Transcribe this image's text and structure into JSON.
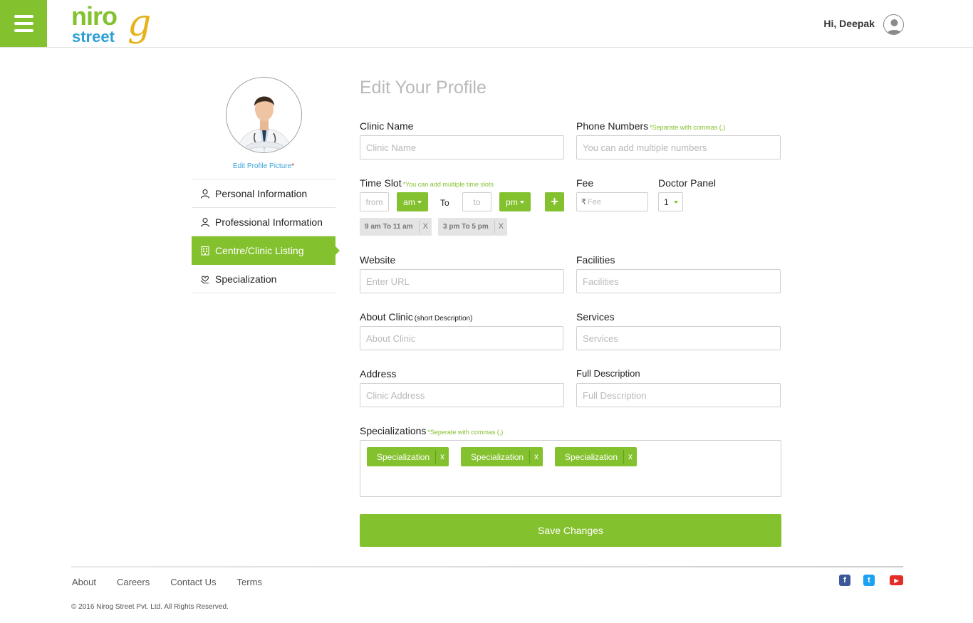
{
  "header": {
    "logo_word1": "niro",
    "logo_word2": "street",
    "logo_mark": "g",
    "greeting": "Hi, Deepak",
    "brand_color": "#84c12e",
    "accent_blue": "#2e9fd6",
    "accent_gold": "#e6b21e"
  },
  "sidebar": {
    "edit_picture": "Edit Profile Picture",
    "edit_star": "*",
    "items": [
      {
        "label": "Personal Information",
        "icon": "user-icon",
        "active": false
      },
      {
        "label": "Professional Information",
        "icon": "user-icon",
        "active": false
      },
      {
        "label": "Centre/Clinic Listing",
        "icon": "clinic-building-icon",
        "active": true
      },
      {
        "label": "Specialization",
        "icon": "heart-hand-icon",
        "active": false
      }
    ]
  },
  "form": {
    "title": "Edit Your Profile",
    "clinic_name": {
      "label": "Clinic Name",
      "placeholder": "Clinic Name",
      "value": ""
    },
    "phone": {
      "label": "Phone Numbers",
      "note": "*Separate with commas (,)",
      "placeholder": "You can add multiple numbers",
      "value": ""
    },
    "time_slot": {
      "label": "Time Slot",
      "note": "*You can add multiple time slots",
      "from_placeholder": "from",
      "from_meridiem": "am",
      "to_text": "To",
      "to_placeholder": "to",
      "to_meridiem": "pm",
      "add_symbol": "+",
      "slots": [
        {
          "text": "9 am To 11 am",
          "remove": "X"
        },
        {
          "text": "3 pm To 5 pm",
          "remove": "X"
        }
      ]
    },
    "fee": {
      "label": "Fee",
      "currency": "₹",
      "placeholder": "Fee",
      "value": ""
    },
    "doctor_panel": {
      "label": "Doctor Panel",
      "value": "1"
    },
    "website": {
      "label": "Website",
      "placeholder": "Enter URL",
      "value": ""
    },
    "facilities": {
      "label": "Facilities",
      "placeholder": "Facilities",
      "value": ""
    },
    "about": {
      "label": "About Clinic",
      "note": "(short Description)",
      "placeholder": "About Clinic",
      "value": ""
    },
    "services": {
      "label": "Services",
      "placeholder": "Services",
      "value": ""
    },
    "address": {
      "label": "Address",
      "placeholder": "Clinic Address",
      "value": ""
    },
    "full_description": {
      "label": "Full Description",
      "placeholder": "Full Description",
      "value": ""
    },
    "specializations": {
      "label": "Specializations",
      "note": "*Seperate with commas (,)",
      "chips": [
        {
          "text": "Specialization",
          "remove": "x"
        },
        {
          "text": "Specialization",
          "remove": "x"
        },
        {
          "text": "Specialization",
          "remove": "x"
        }
      ]
    },
    "save_label": "Save Changes"
  },
  "footer": {
    "links": [
      "About",
      "Careers",
      "Contact Us",
      "Terms"
    ],
    "copyright": "© 2016 Nirog Street Pvt. Ltd. All Rights Reserved.",
    "social": [
      {
        "icon": "facebook-icon",
        "glyph": "f",
        "color": "#3b5998"
      },
      {
        "icon": "twitter-icon",
        "glyph": "t",
        "color": "#1da1f2"
      },
      {
        "icon": "youtube-icon",
        "glyph": "▶",
        "color": "#e52d27"
      }
    ]
  }
}
